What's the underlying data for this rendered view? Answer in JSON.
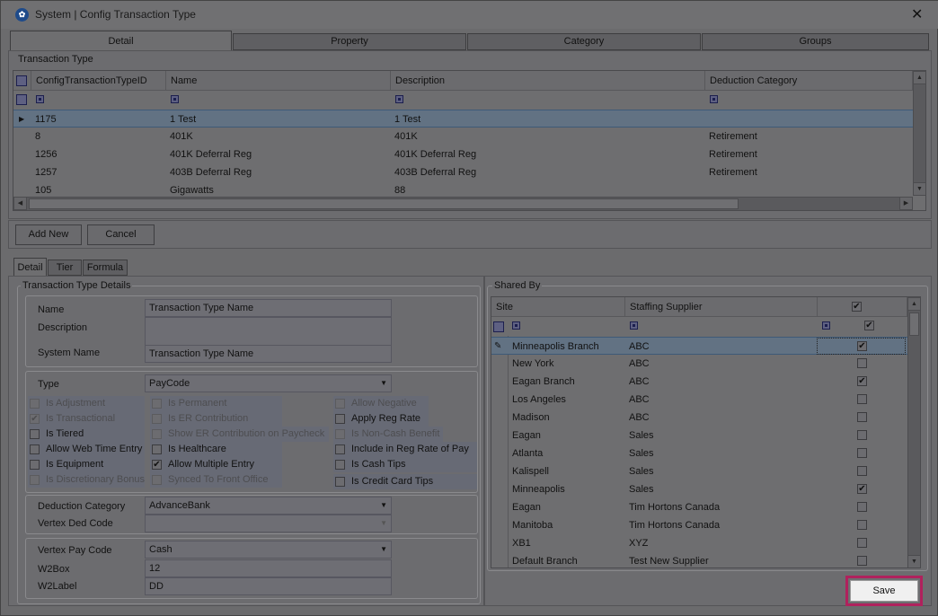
{
  "window": {
    "title": "System | Config Transaction Type",
    "close": "✕"
  },
  "tabs": [
    {
      "label": "Detail"
    },
    {
      "label": "Property"
    },
    {
      "label": "Category"
    },
    {
      "label": "Groups"
    }
  ],
  "transaction_grid": {
    "section_label": "Transaction Type",
    "columns": [
      "ConfigTransactionTypeID",
      "Name",
      "Description",
      "Deduction Category"
    ],
    "rows": [
      {
        "id": "1175",
        "name": "1 Test",
        "description": "1 Test",
        "category": ""
      },
      {
        "id": "8",
        "name": "401K",
        "description": "401K",
        "category": "Retirement"
      },
      {
        "id": "1256",
        "name": "401K Deferral Reg",
        "description": "401K Deferral Reg",
        "category": "Retirement"
      },
      {
        "id": "1257",
        "name": "403B Deferral Reg",
        "description": "403B Deferral Reg",
        "category": "Retirement"
      },
      {
        "id": "105",
        "name": "Gigawatts",
        "description": "88",
        "category": ""
      }
    ]
  },
  "actions": {
    "add_new": "Add New",
    "cancel": "Cancel"
  },
  "subtabs": [
    {
      "label": "Detail"
    },
    {
      "label": "Tier"
    },
    {
      "label": "Formula"
    }
  ],
  "details": {
    "section_label": "Transaction Type Details",
    "name_label": "Name",
    "name_value": "Transaction Type Name",
    "description_label": "Description",
    "description_value": "",
    "system_name_label": "System Name",
    "system_name_value": "Transaction Type Name",
    "type_label": "Type",
    "type_value": "PayCode",
    "deduction_category_label": "Deduction Category",
    "deduction_category_value": "AdvanceBank",
    "vertex_ded_label": "Vertex Ded Code",
    "vertex_ded_value": "",
    "vertex_pay_label": "Vertex Pay Code",
    "vertex_pay_value": "Cash",
    "w2box_label": "W2Box",
    "w2box_value": "12",
    "w2label_label": "W2Label",
    "w2label_value": "DD"
  },
  "checkboxes": {
    "col1": [
      {
        "label": "Is Adjustment",
        "checked": false,
        "disabled": true
      },
      {
        "label": "Is Transactional",
        "checked": true,
        "disabled": true
      },
      {
        "label": "Is Tiered",
        "checked": false,
        "disabled": false
      },
      {
        "label": "Allow Web Time Entry",
        "checked": false,
        "disabled": false
      },
      {
        "label": "Is Equipment",
        "checked": false,
        "disabled": false
      },
      {
        "label": "Is Discretionary Bonus",
        "checked": false,
        "disabled": true
      }
    ],
    "col2": [
      {
        "label": "Is Permanent",
        "checked": false,
        "disabled": true
      },
      {
        "label": "Is ER Contribution",
        "checked": false,
        "disabled": true
      },
      {
        "label": "Show ER Contribution on Paycheck",
        "checked": false,
        "disabled": true
      },
      {
        "label": "Is Healthcare",
        "checked": false,
        "disabled": false
      },
      {
        "label": "Allow Multiple Entry",
        "checked": true,
        "disabled": false
      },
      {
        "label": "Synced To Front Office",
        "checked": false,
        "disabled": true
      }
    ],
    "col3": [
      {
        "label": "Allow Negative",
        "checked": false,
        "disabled": true
      },
      {
        "label": "Apply Reg Rate",
        "checked": false,
        "disabled": false
      },
      {
        "label": "Is Non-Cash Benefit",
        "checked": false,
        "disabled": true
      },
      {
        "label": "Include in Reg Rate of Pay",
        "checked": false,
        "disabled": false
      },
      {
        "label": "Is Cash Tips",
        "checked": false,
        "disabled": false
      },
      {
        "label": "Is Credit Card Tips",
        "checked": false,
        "disabled": false
      }
    ],
    "check_mark": "✔"
  },
  "shared_by": {
    "section_label": "Shared By",
    "columns": [
      "Site",
      "Staffing Supplier"
    ],
    "rows": [
      {
        "site": "Minneapolis Branch",
        "supplier": "ABC",
        "checked": true
      },
      {
        "site": "New York",
        "supplier": "ABC",
        "checked": false
      },
      {
        "site": "Eagan Branch",
        "supplier": "ABC",
        "checked": true
      },
      {
        "site": "Los Angeles",
        "supplier": "ABC",
        "checked": false
      },
      {
        "site": "Madison",
        "supplier": "ABC",
        "checked": false
      },
      {
        "site": "Eagan",
        "supplier": "Sales",
        "checked": false
      },
      {
        "site": "Atlanta",
        "supplier": "Sales",
        "checked": false
      },
      {
        "site": "Kalispell",
        "supplier": "Sales",
        "checked": false
      },
      {
        "site": "Minneapolis",
        "supplier": "Sales",
        "checked": true
      },
      {
        "site": "Eagan",
        "supplier": "Tim Hortons Canada",
        "checked": false
      },
      {
        "site": "Manitoba",
        "supplier": "Tim Hortons Canada",
        "checked": false
      },
      {
        "site": "XB1",
        "supplier": "XYZ",
        "checked": false
      },
      {
        "site": "Default Branch",
        "supplier": "Test New Supplier",
        "checked": false
      }
    ]
  },
  "save_label": "Save",
  "colors": {
    "highlight": "#b0215d",
    "selection": "#627283"
  }
}
